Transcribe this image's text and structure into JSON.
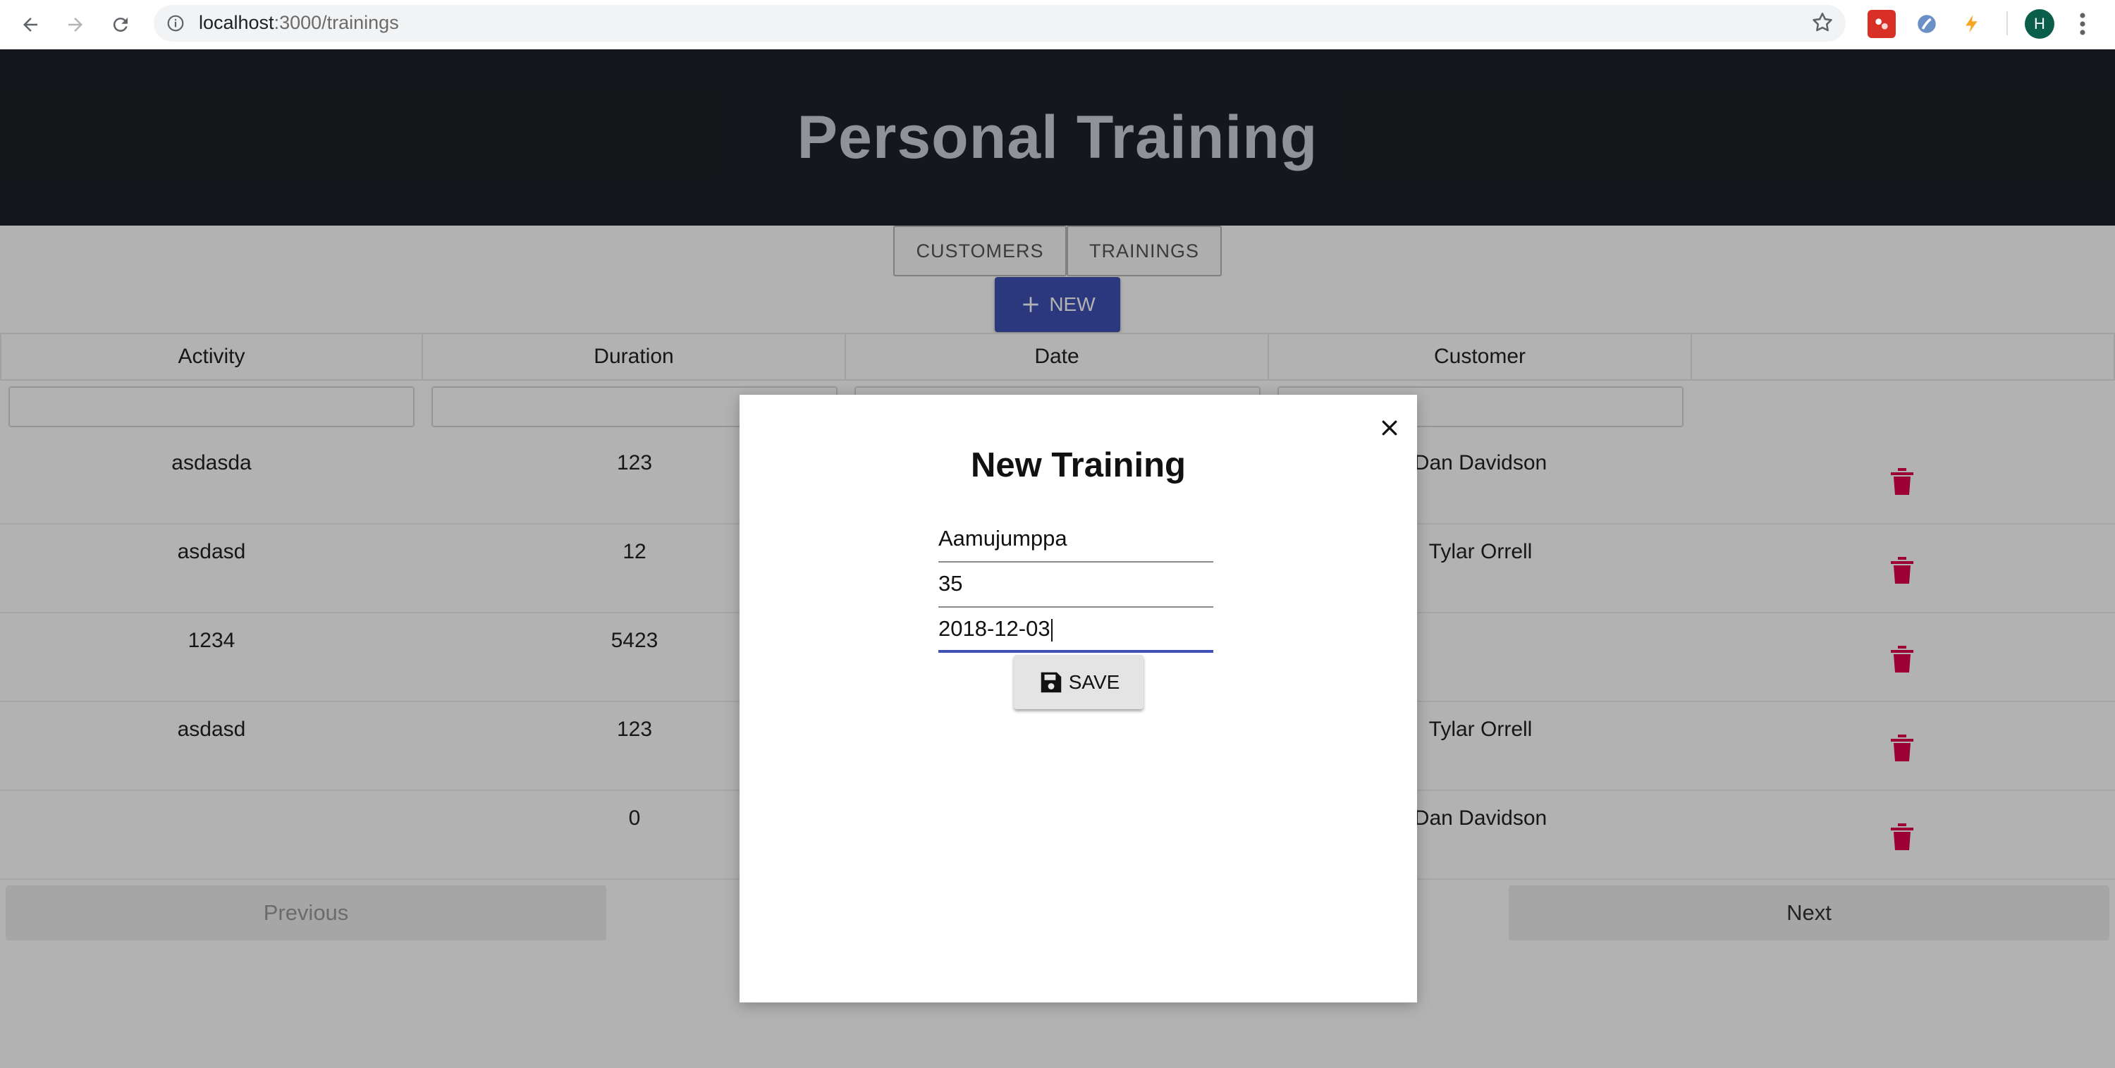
{
  "browser": {
    "url_host": "localhost",
    "url_path": ":3000/trainings",
    "profile_initial": "H"
  },
  "app": {
    "title": "Personal Training",
    "nav": {
      "customers_label": "CUSTOMERS",
      "trainings_label": "TRAININGS"
    },
    "new_button_label": "NEW"
  },
  "table": {
    "headers": [
      "Activity",
      "Duration",
      "Date",
      "Customer",
      ""
    ],
    "rows": [
      {
        "activity": "asdasda",
        "duration": "123",
        "customer": "Dan Davidson"
      },
      {
        "activity": "asdasd",
        "duration": "12",
        "customer": "Tylar Orrell"
      },
      {
        "activity": "1234",
        "duration": "5423",
        "customer": ""
      },
      {
        "activity": "asdasd",
        "duration": "123",
        "customer": "Tylar Orrell"
      },
      {
        "activity": "",
        "duration": "0",
        "customer": "Dan Davidson"
      }
    ],
    "previous_label": "Previous",
    "next_label": "Next"
  },
  "modal": {
    "title": "New Training",
    "fields": [
      "Aamujumppa",
      "35",
      "2018-12-03"
    ],
    "save_label": "SAVE"
  },
  "colors": {
    "header_bg": "#1e2127",
    "primary": "#3f51b5",
    "delete": "#e0004d"
  },
  "icons": [
    "back-arrow-icon",
    "forward-arrow-icon",
    "reload-icon",
    "info-icon",
    "star-icon",
    "close-icon",
    "save-icon",
    "add-icon",
    "trash-icon"
  ]
}
